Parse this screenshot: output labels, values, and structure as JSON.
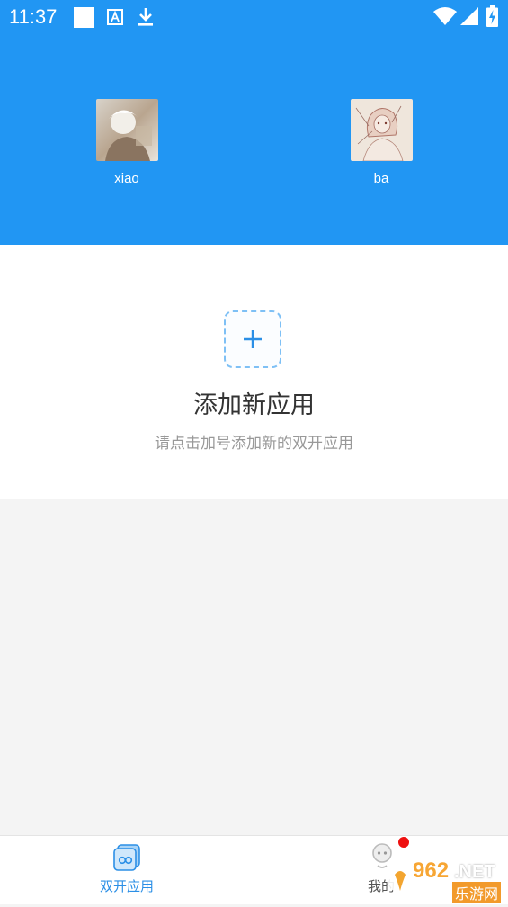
{
  "status_bar": {
    "time": "11:37"
  },
  "accounts": [
    {
      "name": "xiao"
    },
    {
      "name": "ba"
    }
  ],
  "add_app": {
    "title": "添加新应用",
    "hint": "请点击加号添加新的双开应用"
  },
  "bottom_nav": {
    "items": [
      {
        "label": "双开应用",
        "icon": "dual-app-icon",
        "active": true
      },
      {
        "label": "我的",
        "icon": "profile-icon",
        "active": false,
        "badge": true
      }
    ]
  },
  "watermark": {
    "brand_number": "962",
    "brand_suffix": ".NET",
    "brand_cn": "乐游网"
  },
  "colors": {
    "primary": "#2196f3",
    "active_tab": "#2b8fe6",
    "badge": "#ee1010",
    "dashed_border": "#7ec0f5"
  }
}
